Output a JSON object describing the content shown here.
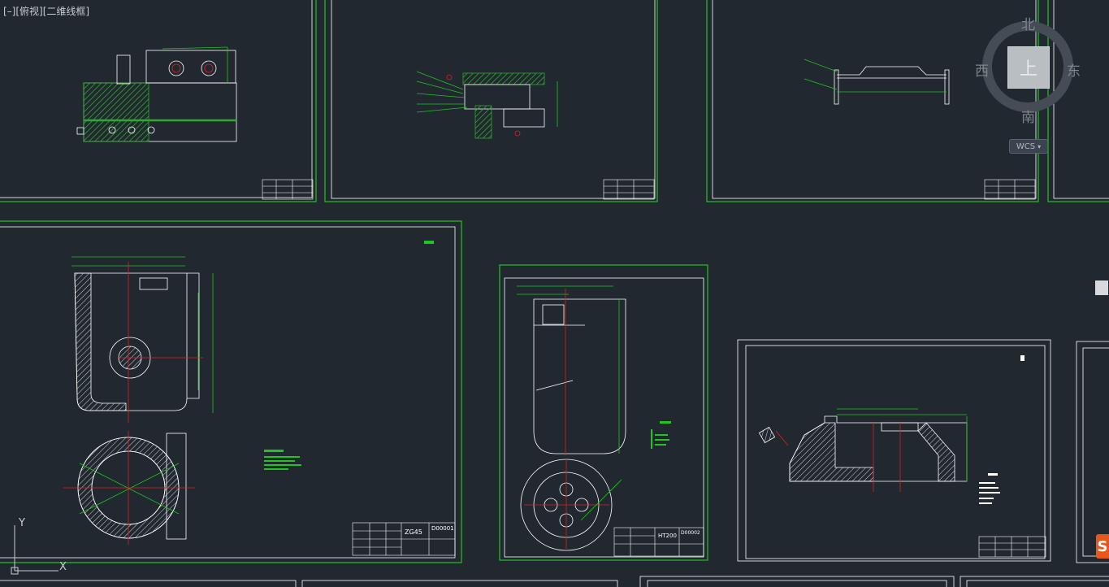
{
  "viewport": {
    "label_prefix": "[–]",
    "view_name": "[俯视]",
    "visual_style": "[二维线框]"
  },
  "viewcube": {
    "north": "北",
    "south": "南",
    "east": "东",
    "west": "西",
    "face": "上",
    "wcs_label": "WCS"
  },
  "ucs": {
    "y_label": "Y",
    "x_label": "X"
  },
  "title_blocks": {
    "sheet4_material": "ZG45",
    "sheet4_code": "D00001",
    "sheet5_material": "HT200",
    "sheet5_code": "D00002"
  },
  "colors": {
    "background": "#212830",
    "frame": "#22c322",
    "white": "#ffffff",
    "centerline": "#e02020",
    "hatch": "#2ea82e"
  },
  "icons": {
    "ucs": "ucs-axes-icon",
    "logo": "app-logo-icon"
  }
}
